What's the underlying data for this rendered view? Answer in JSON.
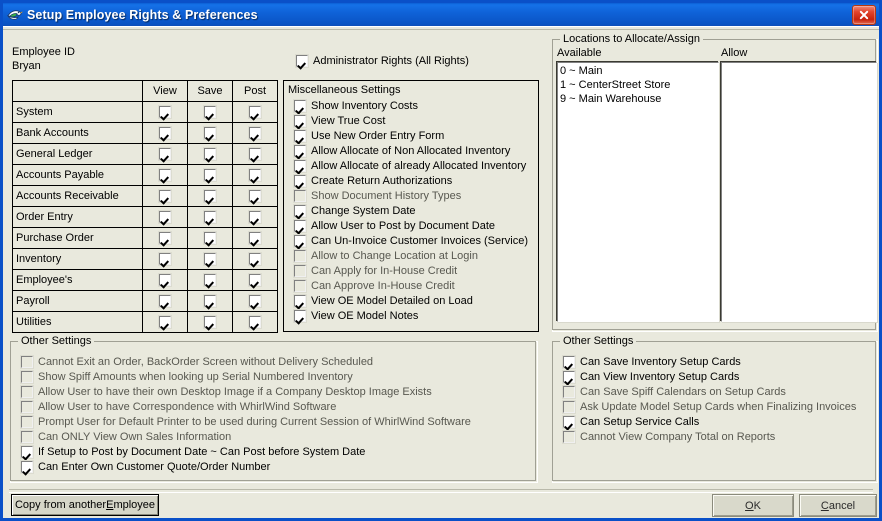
{
  "window": {
    "title": "Setup Employee Rights & Preferences",
    "icon": "whirlwind-bird-icon",
    "close_label": "Close",
    "titlebar_color": "#0f62d8",
    "face_color": "#e9e9dd"
  },
  "employee": {
    "id_label": "Employee ID",
    "id_value": "Bryan"
  },
  "admin": {
    "label": "Administrator Rights (All Rights)",
    "checked": true
  },
  "permissions": {
    "columns": [
      "",
      "View",
      "Save",
      "Post"
    ],
    "rows": [
      {
        "name": "System",
        "view": true,
        "save": true,
        "post": true
      },
      {
        "name": "Bank Accounts",
        "view": true,
        "save": true,
        "post": true
      },
      {
        "name": "General Ledger",
        "view": true,
        "save": true,
        "post": true
      },
      {
        "name": "Accounts Payable",
        "view": true,
        "save": true,
        "post": true
      },
      {
        "name": "Accounts Receivable",
        "view": true,
        "save": true,
        "post": true
      },
      {
        "name": "Order Entry",
        "view": true,
        "save": true,
        "post": true
      },
      {
        "name": "Purchase Order",
        "view": true,
        "save": true,
        "post": true
      },
      {
        "name": "Inventory",
        "view": true,
        "save": true,
        "post": true
      },
      {
        "name": "Employee's",
        "view": true,
        "save": true,
        "post": true
      },
      {
        "name": "Payroll",
        "view": true,
        "save": true,
        "post": true
      },
      {
        "name": "Utilities",
        "view": true,
        "save": true,
        "post": true
      }
    ]
  },
  "misc_settings": {
    "title": "Miscellaneous Settings",
    "items": [
      {
        "label": "Show Inventory Costs",
        "checked": true,
        "enabled": true
      },
      {
        "label": "View True Cost",
        "checked": true,
        "enabled": true
      },
      {
        "label": "Use New Order Entry Form",
        "checked": true,
        "enabled": true
      },
      {
        "label": "Allow Allocate of Non Allocated Inventory",
        "checked": true,
        "enabled": true
      },
      {
        "label": "Allow Allocate of already Allocated Inventory",
        "checked": true,
        "enabled": true
      },
      {
        "label": "Create Return Authorizations",
        "checked": true,
        "enabled": true
      },
      {
        "label": "Show Document History Types",
        "checked": false,
        "enabled": true
      },
      {
        "label": "Change System Date",
        "checked": true,
        "enabled": true
      },
      {
        "label": "Allow User to Post by Document Date",
        "checked": true,
        "enabled": true
      },
      {
        "label": "Can Un-Invoice Customer Invoices (Service)",
        "checked": true,
        "enabled": true
      },
      {
        "label": "Allow to Change Location at Login",
        "checked": false,
        "enabled": false
      },
      {
        "label": "Can Apply for In-House Credit",
        "checked": false,
        "enabled": false
      },
      {
        "label": "Can Approve In-House Credit",
        "checked": false,
        "enabled": false
      },
      {
        "label": "View OE Model Detailed on Load",
        "checked": true,
        "enabled": true
      },
      {
        "label": "View OE Model Notes",
        "checked": true,
        "enabled": true
      }
    ]
  },
  "other_settings_left": {
    "title": "Other Settings",
    "items": [
      {
        "label": "Cannot Exit an Order, BackOrder Screen without Delivery Scheduled",
        "checked": false
      },
      {
        "label": "Show Spiff Amounts when looking up Serial Numbered Inventory",
        "checked": false
      },
      {
        "label": "Allow User to have their own Desktop Image if a Company Desktop Image Exists",
        "checked": false
      },
      {
        "label": "Allow User to have Correspondence with WhirlWind Software",
        "checked": false
      },
      {
        "label": "Prompt User for Default Printer to be used during Current Session of WhirlWind Software",
        "checked": false
      },
      {
        "label": "Can ONLY View Own Sales Information",
        "checked": false
      },
      {
        "label": "If Setup to Post by Document Date ~ Can Post before System Date",
        "checked": true
      },
      {
        "label": "Can Enter Own Customer Quote/Order Number",
        "checked": true
      }
    ]
  },
  "locations": {
    "title": "Locations to Allocate/Assign",
    "available_label": "Available",
    "allow_label": "Allow",
    "available_items": [
      "0 ~ Main",
      "1 ~ CenterStreet Store",
      "9 ~ Main Warehouse"
    ],
    "allow_items": []
  },
  "other_settings_right": {
    "title": "Other Settings",
    "items": [
      {
        "label": "Can Save Inventory Setup Cards",
        "checked": true
      },
      {
        "label": "Can View Inventory Setup Cards",
        "checked": true
      },
      {
        "label": "Can Save Spiff Calendars on Setup Cards",
        "checked": false
      },
      {
        "label": "Ask Update Model Setup Cards when Finalizing Invoices",
        "checked": false
      },
      {
        "label": "Can Setup Service Calls",
        "checked": true
      },
      {
        "label": "Cannot View Company Total on Reports",
        "checked": false
      }
    ]
  },
  "buttons": {
    "copy": {
      "pre": "Copy from another ",
      "accel": "E",
      "post": "mployee"
    },
    "ok": {
      "accel": "O",
      "post": "K"
    },
    "cancel": {
      "pre": "",
      "accel": "C",
      "post": "ancel"
    }
  }
}
